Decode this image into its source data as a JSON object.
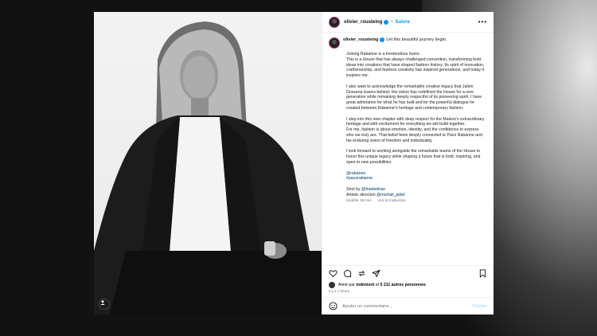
{
  "post": {
    "username": "olivier_rousteing",
    "follow_label": "Suivre",
    "more_label": "•••",
    "dot": "•",
    "caption_first": "Let this beautiful journey begin.",
    "paragraphs": [
      "Joining Rabanne is a tremendous honor.\nThis is a House that has always challenged convention, transforming bold ideas into creations that have shaped fashion history. Its spirit of innovation, craftsmanship, and fearless creativity has inspired generations, and today it inspires me.",
      "I also want to acknowledge the remarkable creative legacy that Julien Dossena leaves behind. His vision has redefined the House for a new generation while remaining deeply respectful of its pioneering spirit. I have great admiration for what he has built and for the powerful dialogue he created between Rabanne's heritage and contemporary fashion.",
      "I step into this new chapter with deep respect for the Maison's extraordinary heritage and with excitement for everything we will build together.\nFor me, fashion is about emotion, identity, and the confidence to express who we truly are. That belief feels deeply connected to Paco Rabanne and his enduring vision of freedom and individuality.",
      "I look forward to working alongside the remarkable teams of the House to honor this unique legacy while shaping a future that is bold, inspiring, and open to new possibilities."
    ],
    "mention_1": "@rabanne",
    "hashtag_1": "#pacorabanne",
    "shot_by_label": "Shot by",
    "shot_by_handle": "@franbeltran",
    "art_direction_label": "Artistic direction",
    "art_direction_handle": "@michail_pelet",
    "modified_label": "Modifié",
    "modified_time": "59 min",
    "translate_label": "Voir la traduction"
  },
  "likes": {
    "prefix": "Aimé par",
    "user": "mdenisot",
    "connector": "et",
    "count_text": "5 211 autres personnes"
  },
  "timestamp": "il y a 1 heure",
  "comment": {
    "placeholder": "Ajouter un commentaire…",
    "publish_label": "Publier"
  },
  "colors": {
    "accent": "#0095f6",
    "link": "#00376b",
    "backdrop": "#121212"
  },
  "icons": [
    "heart-icon",
    "comment-icon",
    "share-icon",
    "send-icon",
    "bookmark-icon",
    "emoji-icon",
    "tag-user-icon",
    "more-options-icon",
    "verified-badge-icon"
  ]
}
